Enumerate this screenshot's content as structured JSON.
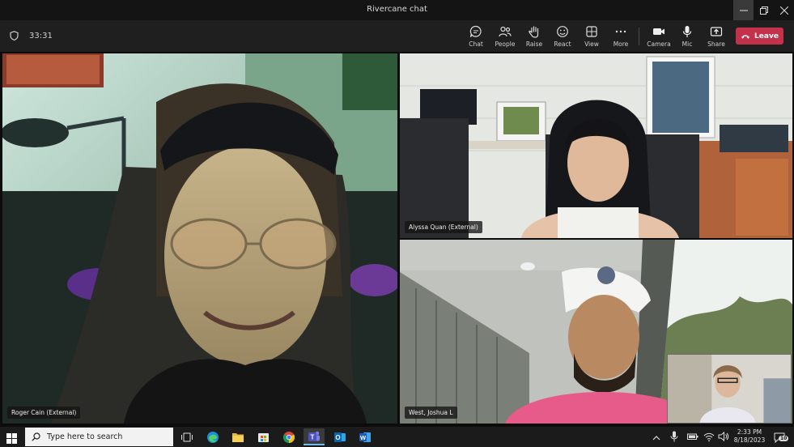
{
  "window": {
    "title": "Rivercane chat"
  },
  "meeting": {
    "timer": "33:31",
    "toolbar": [
      {
        "id": "chat",
        "label": "Chat",
        "icon": "chat-icon"
      },
      {
        "id": "people",
        "label": "People",
        "icon": "people-icon"
      },
      {
        "id": "raise",
        "label": "Raise",
        "icon": "raise-hand-icon"
      },
      {
        "id": "react",
        "label": "React",
        "icon": "smiley-icon"
      },
      {
        "id": "view",
        "label": "View",
        "icon": "grid-view-icon"
      },
      {
        "id": "more",
        "label": "More",
        "icon": "more-icon"
      },
      {
        "id": "camera",
        "label": "Camera",
        "icon": "camera-icon"
      },
      {
        "id": "mic",
        "label": "Mic",
        "icon": "mic-icon"
      },
      {
        "id": "share",
        "label": "Share",
        "icon": "share-icon"
      }
    ],
    "leave_label": "Leave",
    "leave_color": "#c4314b"
  },
  "participants": [
    {
      "name": "Roger Cain (External)"
    },
    {
      "name": "Alyssa Quan (External)"
    },
    {
      "name": "West, Joshua L"
    }
  ],
  "taskbar": {
    "search_placeholder": "Type here to search",
    "time": "2:33 PM",
    "date": "8/18/2023",
    "notification_count": "10",
    "apps": [
      "task-view-icon",
      "edge-icon",
      "file-explorer-icon",
      "store-icon",
      "chrome-icon",
      "teams-icon",
      "outlook-icon",
      "word-icon"
    ]
  }
}
